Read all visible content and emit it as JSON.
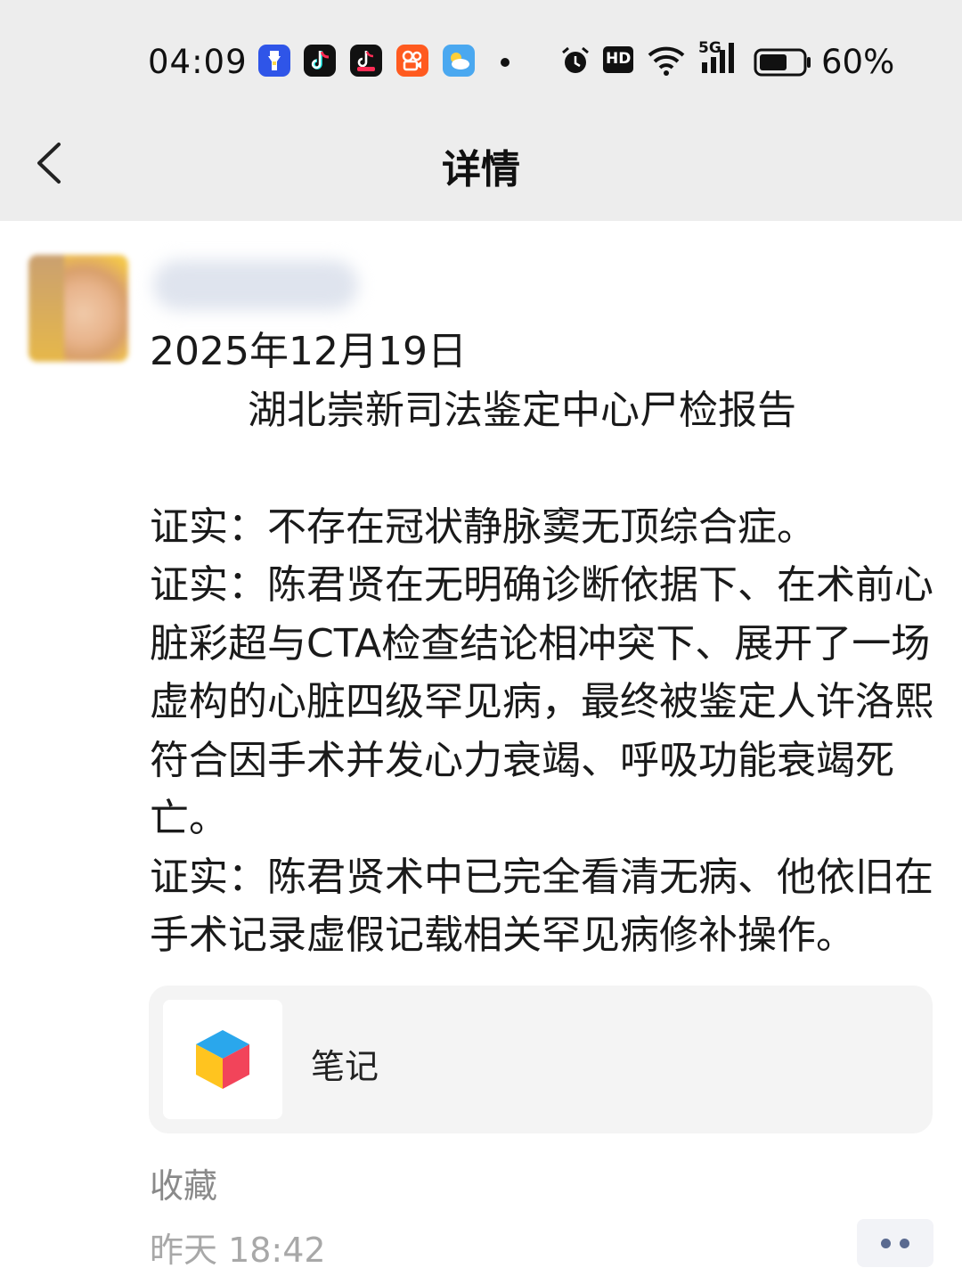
{
  "status_bar": {
    "time": "04:09",
    "battery": "60%",
    "network": "5G",
    "hd": "HD",
    "apps": [
      "flashlight-app-icon",
      "douyin-app-icon",
      "douyin-lite-app-icon",
      "kuaishou-app-icon",
      "weather-app-icon"
    ]
  },
  "nav": {
    "title": "详情",
    "back_icon": "back-chevron-icon"
  },
  "post": {
    "date_line": "2025年12月19日",
    "heading": "湖北崇新司法鉴定中心尸检报告",
    "paragraphs": [
      "证实：不存在冠状静脉窦无顶综合症。",
      "证实：陈君贤在无明确诊断依据下、在术前心脏彩超与CTA检查结论相冲突下、展开了一场虚构的心脏四级罕见病，最终被鉴定人许洛熙符合因手术并发心力衰竭、呼吸功能衰竭死亡。",
      "证实：陈君贤术中已完全看清无病、他依旧在手术记录虚假记载相关罕见病修补操作。"
    ],
    "attachment": {
      "label": "笔记",
      "icon": "cube-app-icon"
    },
    "favorite_label": "收藏",
    "timestamp": "昨天 18:42",
    "more_icon": "more-dots-icon"
  },
  "colors": {
    "topbar": "#ededed",
    "card": "#f4f4f4",
    "muted": "#8a8a8a",
    "more_dots": "#5a6a90"
  }
}
